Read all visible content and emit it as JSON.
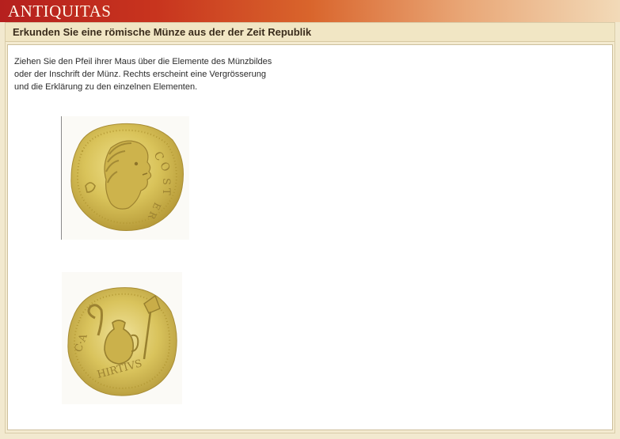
{
  "app": {
    "brand": "ANTIQUITAS"
  },
  "page": {
    "title": "Erkunden Sie eine römische Münze aus der der Zeit Republik"
  },
  "instructions": {
    "lines": [
      "Ziehen Sie den Pfeil ihrer Maus über die  Elemente des Münzbildes",
      "oder der Inschrift der Münz. Rechts  erscheint eine Vergrösserung",
      "und die Erklärung zu den einzelnen Elementen."
    ]
  },
  "coins": {
    "obverse": {
      "legend": "COS TER",
      "icon": "coin-obverse-head-image"
    },
    "reverse": {
      "legend": "C·A·HIRTIVS",
      "icon": "coin-reverse-jug-image"
    }
  },
  "colors": {
    "banner_start": "#b5201e",
    "banner_end": "#f2dab8",
    "page_bg": "#f2e9cf",
    "gold": "#d8c25a"
  }
}
